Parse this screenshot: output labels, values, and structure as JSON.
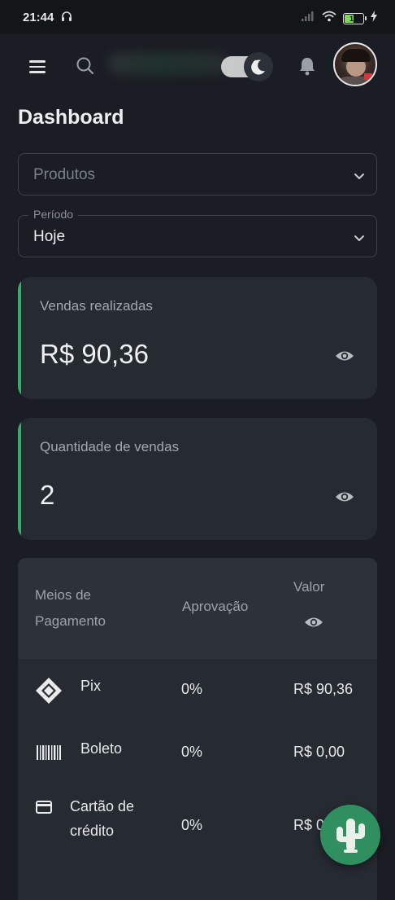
{
  "status_bar": {
    "time": "21:44",
    "battery": "17"
  },
  "header": {
    "title": "Dashboard"
  },
  "filters": {
    "products": {
      "placeholder": "Produtos"
    },
    "period": {
      "label": "Período",
      "value": "Hoje"
    }
  },
  "cards": {
    "sales": {
      "label": "Vendas realizadas",
      "value": "R$ 90,36"
    },
    "quantity": {
      "label": "Quantidade de vendas",
      "value": "2"
    }
  },
  "payments": {
    "headers": {
      "method_line1": "Meios de",
      "method_line2": "Pagamento",
      "approval": "Aprovação",
      "value": "Valor"
    },
    "rows": [
      {
        "name": "Pix",
        "approval": "0%",
        "value": "R$ 90,36",
        "icon": "pix-icon"
      },
      {
        "name": "Boleto",
        "approval": "0%",
        "value": "R$ 0,00",
        "icon": "barcode-icon"
      },
      {
        "name_line1": "Cartão de",
        "name_line2": "crédito",
        "approval": "0%",
        "value": "R$ 0",
        "icon": "credit-card-icon"
      }
    ]
  },
  "colors": {
    "accent": "#3daa6d",
    "background": "#1a1d23",
    "card": "#262a31",
    "fab": "#2f8f5f"
  }
}
